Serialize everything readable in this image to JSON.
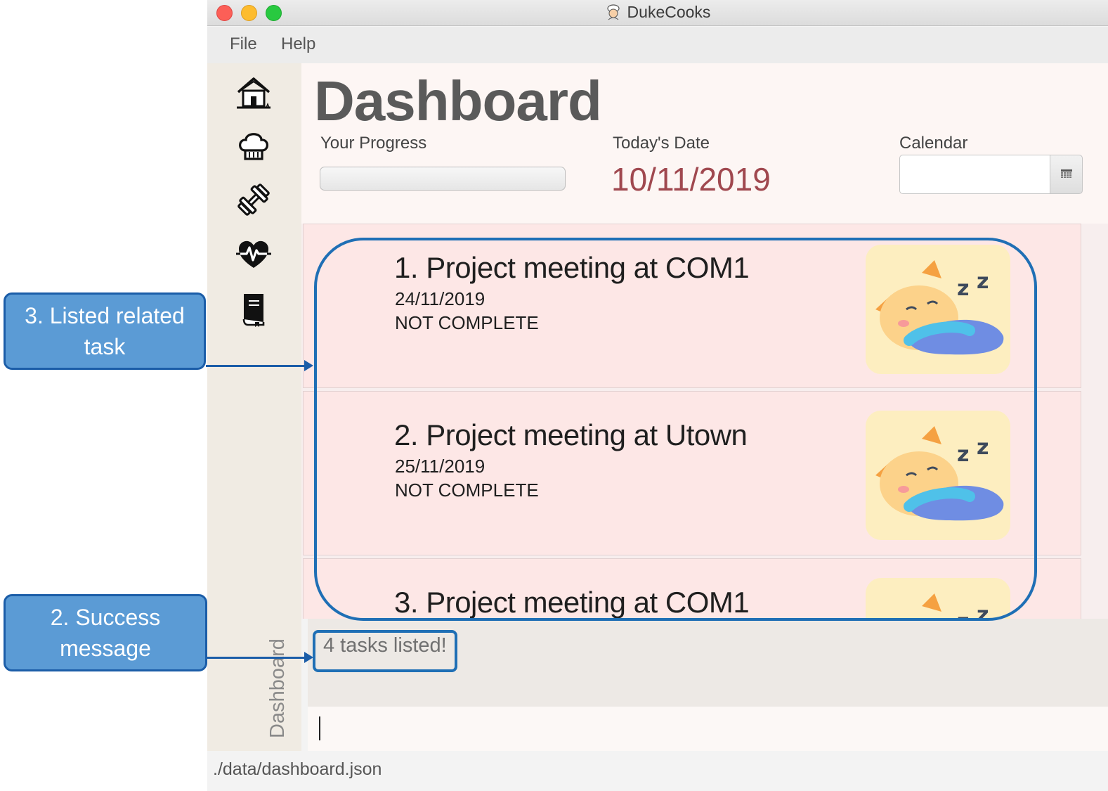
{
  "window": {
    "title": "DukeCooks"
  },
  "menu": {
    "file": "File",
    "help": "Help"
  },
  "sidebar": {
    "items": [
      {
        "icon": "home-icon"
      },
      {
        "icon": "chef-hat-icon"
      },
      {
        "icon": "dumbbell-icon"
      },
      {
        "icon": "heartbeat-icon"
      },
      {
        "icon": "book-icon"
      }
    ],
    "active_label": "Dashboard"
  },
  "dashboard": {
    "title": "Dashboard",
    "progress_label": "Your Progress",
    "progress_fraction": 0,
    "date_label": "Today's Date",
    "date_value": "10/11/2019",
    "calendar_label": "Calendar",
    "calendar_value": ""
  },
  "tasks": [
    {
      "title": "1.  Project meeting at COM1",
      "date": "24/11/2019",
      "status": "NOT COMPLETE"
    },
    {
      "title": "2.  Project meeting at Utown",
      "date": "25/11/2019",
      "status": "NOT COMPLETE"
    },
    {
      "title": "3.  Project meeting at COM1"
    }
  ],
  "result_message": "4 tasks listed!",
  "command_input": "",
  "status_bar": {
    "path": "./data/dashboard.json"
  },
  "annotations": {
    "listed_task": "3. Listed related task",
    "success": "2. Success message"
  },
  "colors": {
    "date_red": "#a0484f",
    "annotation_fill": "#5b9bd5",
    "annotation_border": "#1b5da8",
    "task_card": "#fde7e6",
    "scrollbar": "#a44b4b"
  }
}
